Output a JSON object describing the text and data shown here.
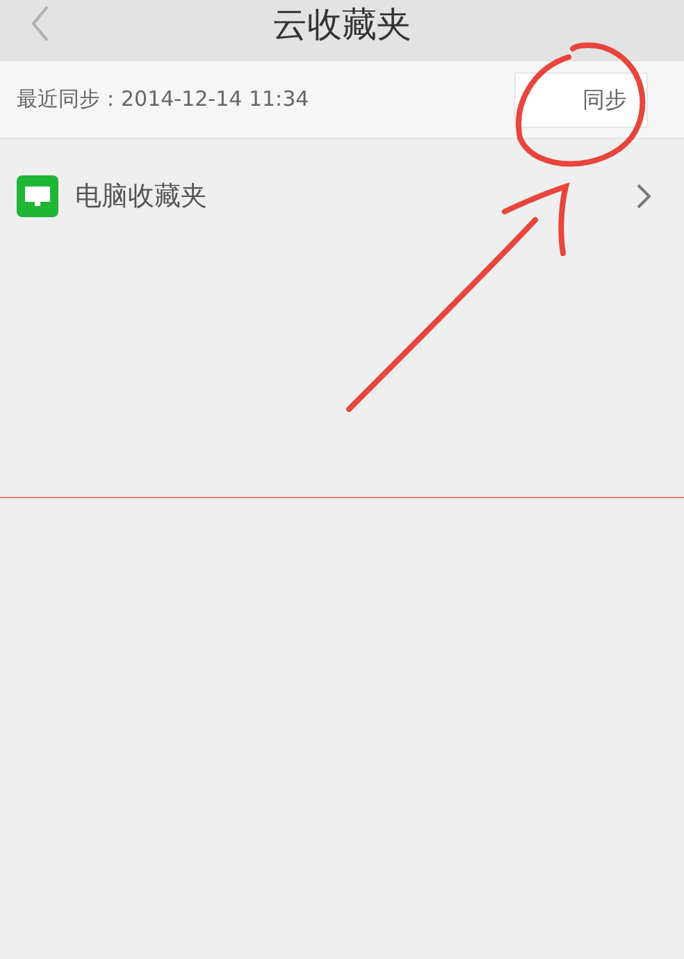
{
  "header": {
    "title": "云收藏夹"
  },
  "sync_bar": {
    "last_sync": "最近同步：2014-12-14 11:34",
    "button": "同步"
  },
  "items": [
    {
      "label": "电脑收藏夹"
    }
  ]
}
